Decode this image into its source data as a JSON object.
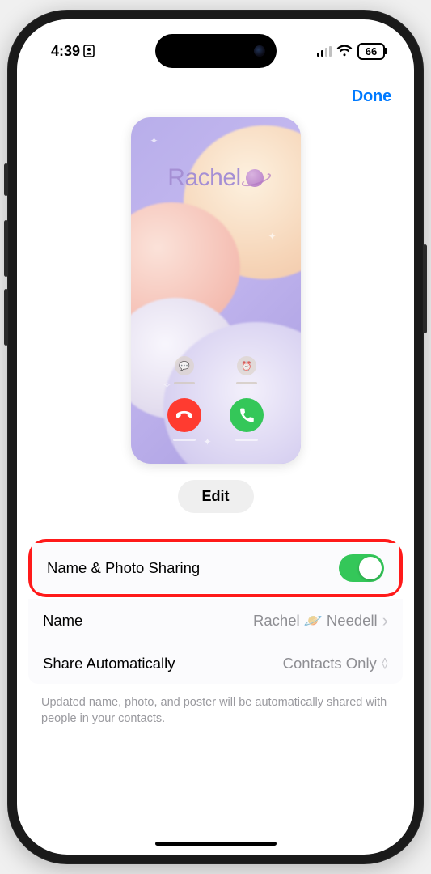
{
  "status": {
    "time": "4:39",
    "battery": "66"
  },
  "nav": {
    "done": "Done"
  },
  "poster": {
    "name": "Rachel"
  },
  "edit_btn": "Edit",
  "rows": {
    "sharing": {
      "label": "Name & Photo Sharing"
    },
    "name": {
      "label": "Name",
      "value": "Rachel 🪐 Needell"
    },
    "share_auto": {
      "label": "Share Automatically",
      "value": "Contacts Only"
    }
  },
  "footer": "Updated name, photo, and poster will be automatically shared with people in your contacts."
}
